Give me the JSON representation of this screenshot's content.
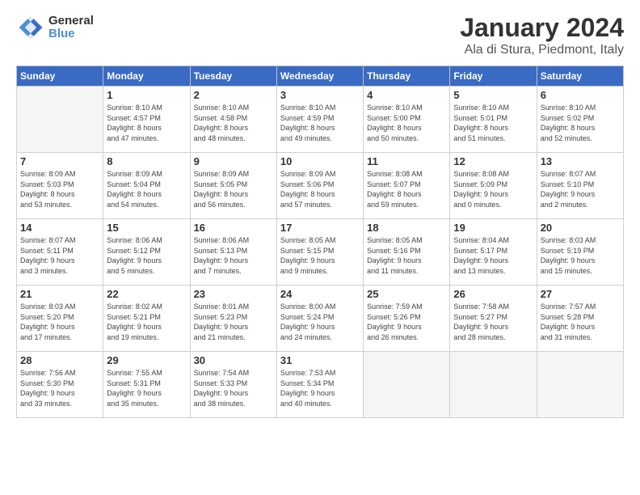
{
  "logo": {
    "text_general": "General",
    "text_blue": "Blue"
  },
  "header": {
    "title": "January 2024",
    "location": "Ala di Stura, Piedmont, Italy"
  },
  "weekdays": [
    "Sunday",
    "Monday",
    "Tuesday",
    "Wednesday",
    "Thursday",
    "Friday",
    "Saturday"
  ],
  "weeks": [
    [
      {
        "day": "",
        "info": ""
      },
      {
        "day": "1",
        "info": "Sunrise: 8:10 AM\nSunset: 4:57 PM\nDaylight: 8 hours\nand 47 minutes."
      },
      {
        "day": "2",
        "info": "Sunrise: 8:10 AM\nSunset: 4:58 PM\nDaylight: 8 hours\nand 48 minutes."
      },
      {
        "day": "3",
        "info": "Sunrise: 8:10 AM\nSunset: 4:59 PM\nDaylight: 8 hours\nand 49 minutes."
      },
      {
        "day": "4",
        "info": "Sunrise: 8:10 AM\nSunset: 5:00 PM\nDaylight: 8 hours\nand 50 minutes."
      },
      {
        "day": "5",
        "info": "Sunrise: 8:10 AM\nSunset: 5:01 PM\nDaylight: 8 hours\nand 51 minutes."
      },
      {
        "day": "6",
        "info": "Sunrise: 8:10 AM\nSunset: 5:02 PM\nDaylight: 8 hours\nand 52 minutes."
      }
    ],
    [
      {
        "day": "7",
        "info": "Sunrise: 8:09 AM\nSunset: 5:03 PM\nDaylight: 8 hours\nand 53 minutes."
      },
      {
        "day": "8",
        "info": "Sunrise: 8:09 AM\nSunset: 5:04 PM\nDaylight: 8 hours\nand 54 minutes."
      },
      {
        "day": "9",
        "info": "Sunrise: 8:09 AM\nSunset: 5:05 PM\nDaylight: 8 hours\nand 56 minutes."
      },
      {
        "day": "10",
        "info": "Sunrise: 8:09 AM\nSunset: 5:06 PM\nDaylight: 8 hours\nand 57 minutes."
      },
      {
        "day": "11",
        "info": "Sunrise: 8:08 AM\nSunset: 5:07 PM\nDaylight: 8 hours\nand 59 minutes."
      },
      {
        "day": "12",
        "info": "Sunrise: 8:08 AM\nSunset: 5:09 PM\nDaylight: 9 hours\nand 0 minutes."
      },
      {
        "day": "13",
        "info": "Sunrise: 8:07 AM\nSunset: 5:10 PM\nDaylight: 9 hours\nand 2 minutes."
      }
    ],
    [
      {
        "day": "14",
        "info": "Sunrise: 8:07 AM\nSunset: 5:11 PM\nDaylight: 9 hours\nand 3 minutes."
      },
      {
        "day": "15",
        "info": "Sunrise: 8:06 AM\nSunset: 5:12 PM\nDaylight: 9 hours\nand 5 minutes."
      },
      {
        "day": "16",
        "info": "Sunrise: 8:06 AM\nSunset: 5:13 PM\nDaylight: 9 hours\nand 7 minutes."
      },
      {
        "day": "17",
        "info": "Sunrise: 8:05 AM\nSunset: 5:15 PM\nDaylight: 9 hours\nand 9 minutes."
      },
      {
        "day": "18",
        "info": "Sunrise: 8:05 AM\nSunset: 5:16 PM\nDaylight: 9 hours\nand 11 minutes."
      },
      {
        "day": "19",
        "info": "Sunrise: 8:04 AM\nSunset: 5:17 PM\nDaylight: 9 hours\nand 13 minutes."
      },
      {
        "day": "20",
        "info": "Sunrise: 8:03 AM\nSunset: 5:19 PM\nDaylight: 9 hours\nand 15 minutes."
      }
    ],
    [
      {
        "day": "21",
        "info": "Sunrise: 8:03 AM\nSunset: 5:20 PM\nDaylight: 9 hours\nand 17 minutes."
      },
      {
        "day": "22",
        "info": "Sunrise: 8:02 AM\nSunset: 5:21 PM\nDaylight: 9 hours\nand 19 minutes."
      },
      {
        "day": "23",
        "info": "Sunrise: 8:01 AM\nSunset: 5:23 PM\nDaylight: 9 hours\nand 21 minutes."
      },
      {
        "day": "24",
        "info": "Sunrise: 8:00 AM\nSunset: 5:24 PM\nDaylight: 9 hours\nand 24 minutes."
      },
      {
        "day": "25",
        "info": "Sunrise: 7:59 AM\nSunset: 5:26 PM\nDaylight: 9 hours\nand 26 minutes."
      },
      {
        "day": "26",
        "info": "Sunrise: 7:58 AM\nSunset: 5:27 PM\nDaylight: 9 hours\nand 28 minutes."
      },
      {
        "day": "27",
        "info": "Sunrise: 7:57 AM\nSunset: 5:28 PM\nDaylight: 9 hours\nand 31 minutes."
      }
    ],
    [
      {
        "day": "28",
        "info": "Sunrise: 7:56 AM\nSunset: 5:30 PM\nDaylight: 9 hours\nand 33 minutes."
      },
      {
        "day": "29",
        "info": "Sunrise: 7:55 AM\nSunset: 5:31 PM\nDaylight: 9 hours\nand 35 minutes."
      },
      {
        "day": "30",
        "info": "Sunrise: 7:54 AM\nSunset: 5:33 PM\nDaylight: 9 hours\nand 38 minutes."
      },
      {
        "day": "31",
        "info": "Sunrise: 7:53 AM\nSunset: 5:34 PM\nDaylight: 9 hours\nand 40 minutes."
      },
      {
        "day": "",
        "info": ""
      },
      {
        "day": "",
        "info": ""
      },
      {
        "day": "",
        "info": ""
      }
    ]
  ]
}
